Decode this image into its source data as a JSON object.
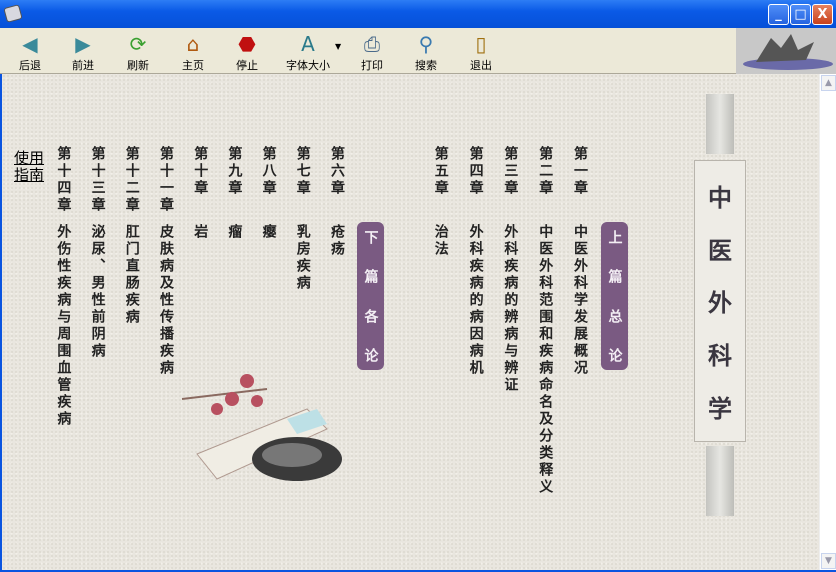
{
  "window": {
    "minimize": "_",
    "maximize": "□",
    "close": "X"
  },
  "toolbar": [
    {
      "label": "后退",
      "icon": "back-arrow-icon",
      "glyph": "◀",
      "color": "#3a8a9a"
    },
    {
      "label": "前进",
      "icon": "forward-arrow-icon",
      "glyph": "▶",
      "color": "#3a8a9a"
    },
    {
      "label": "刷新",
      "icon": "refresh-icon",
      "glyph": "⟳",
      "color": "#3aa030"
    },
    {
      "label": "主页",
      "icon": "home-icon",
      "glyph": "⌂",
      "color": "#b05a10"
    },
    {
      "label": "停止",
      "icon": "stop-icon",
      "glyph": "⬣",
      "color": "#c01010"
    },
    {
      "label": "字体大小",
      "icon": "font-size-icon",
      "glyph": "A",
      "color": "#2a7a8a"
    },
    {
      "label": "打印",
      "icon": "print-icon",
      "glyph": "⎙",
      "color": "#4a6a8a"
    },
    {
      "label": "搜索",
      "icon": "search-icon",
      "glyph": "⚲",
      "color": "#3a7ab0"
    },
    {
      "label": "退出",
      "icon": "exit-door-icon",
      "glyph": "▯",
      "color": "#a07010"
    }
  ],
  "guide": "使用指南",
  "book_title": [
    "中",
    "医",
    "外",
    "科",
    "学"
  ],
  "part1": {
    "label": [
      "上",
      "篇",
      "总",
      "论"
    ]
  },
  "part2": {
    "label": [
      "下",
      "篇",
      "各",
      "论"
    ]
  },
  "part1_chapters": [
    {
      "num": "第一章",
      "title": "中医外科学发展概况"
    },
    {
      "num": "第二章",
      "title": "中医外科范围和疾病命名及分类释义"
    },
    {
      "num": "第三章",
      "title": "外科疾病的辨病与辨证"
    },
    {
      "num": "第四章",
      "title": "外科疾病的病因病机"
    },
    {
      "num": "第五章",
      "title": "治法"
    }
  ],
  "part2_chapters": [
    {
      "num": "第六章",
      "title": "疮疡"
    },
    {
      "num": "第七章",
      "title": "乳房疾病"
    },
    {
      "num": "第八章",
      "title": "瘿"
    },
    {
      "num": "第九章",
      "title": "瘤"
    },
    {
      "num": "第十章",
      "title": "岩"
    },
    {
      "num": "第十一章",
      "title": "皮肤病及性传播疾病"
    },
    {
      "num": "第十二章",
      "title": "肛门直肠疾病"
    },
    {
      "num": "第十三章",
      "title": "泌尿、男性前阴病"
    },
    {
      "num": "第十四章",
      "title": "外伤性疾病与周围血管疾病"
    }
  ]
}
